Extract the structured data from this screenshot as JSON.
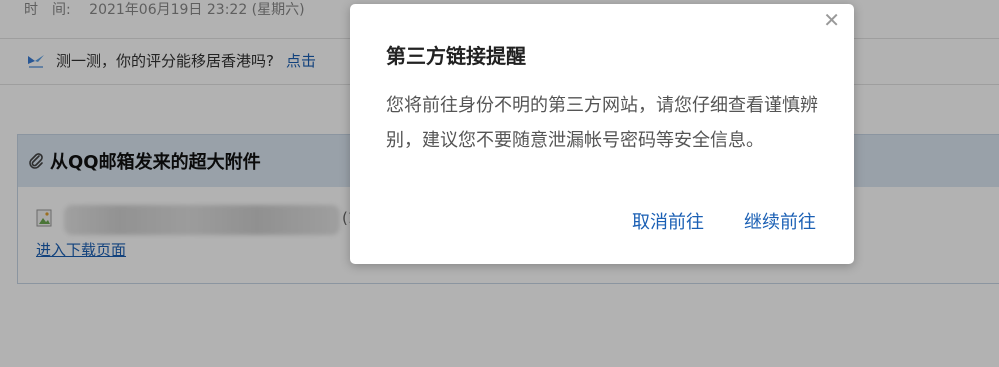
{
  "header": {
    "time_label": "时　间:",
    "time_value": "2021年06月19日 23:22 (星期六)"
  },
  "promo": {
    "icon": "plane-logo-icon",
    "text": "测一测，你的评分能移居香港吗?",
    "link": "点击"
  },
  "attachments": {
    "title": "从QQ邮箱发来的超大附件",
    "icon": "paperclip-icon",
    "item": {
      "size": "(14",
      "download_label": "进入下载页面"
    }
  },
  "dialog": {
    "title": "第三方链接提醒",
    "message": "您将前往身份不明的第三方网站，请您仔细查看谨慎辨别，建议您不要随意泄漏帐号密码等安全信息。",
    "close_icon": "close-icon",
    "close_glyph": "✕",
    "cancel_label": "取消前往",
    "continue_label": "继续前往"
  },
  "colors": {
    "link": "#1a5fb4",
    "overlay": "rgba(0,0,0,0.30)",
    "attach_header_bg": "#dbe7f3"
  }
}
